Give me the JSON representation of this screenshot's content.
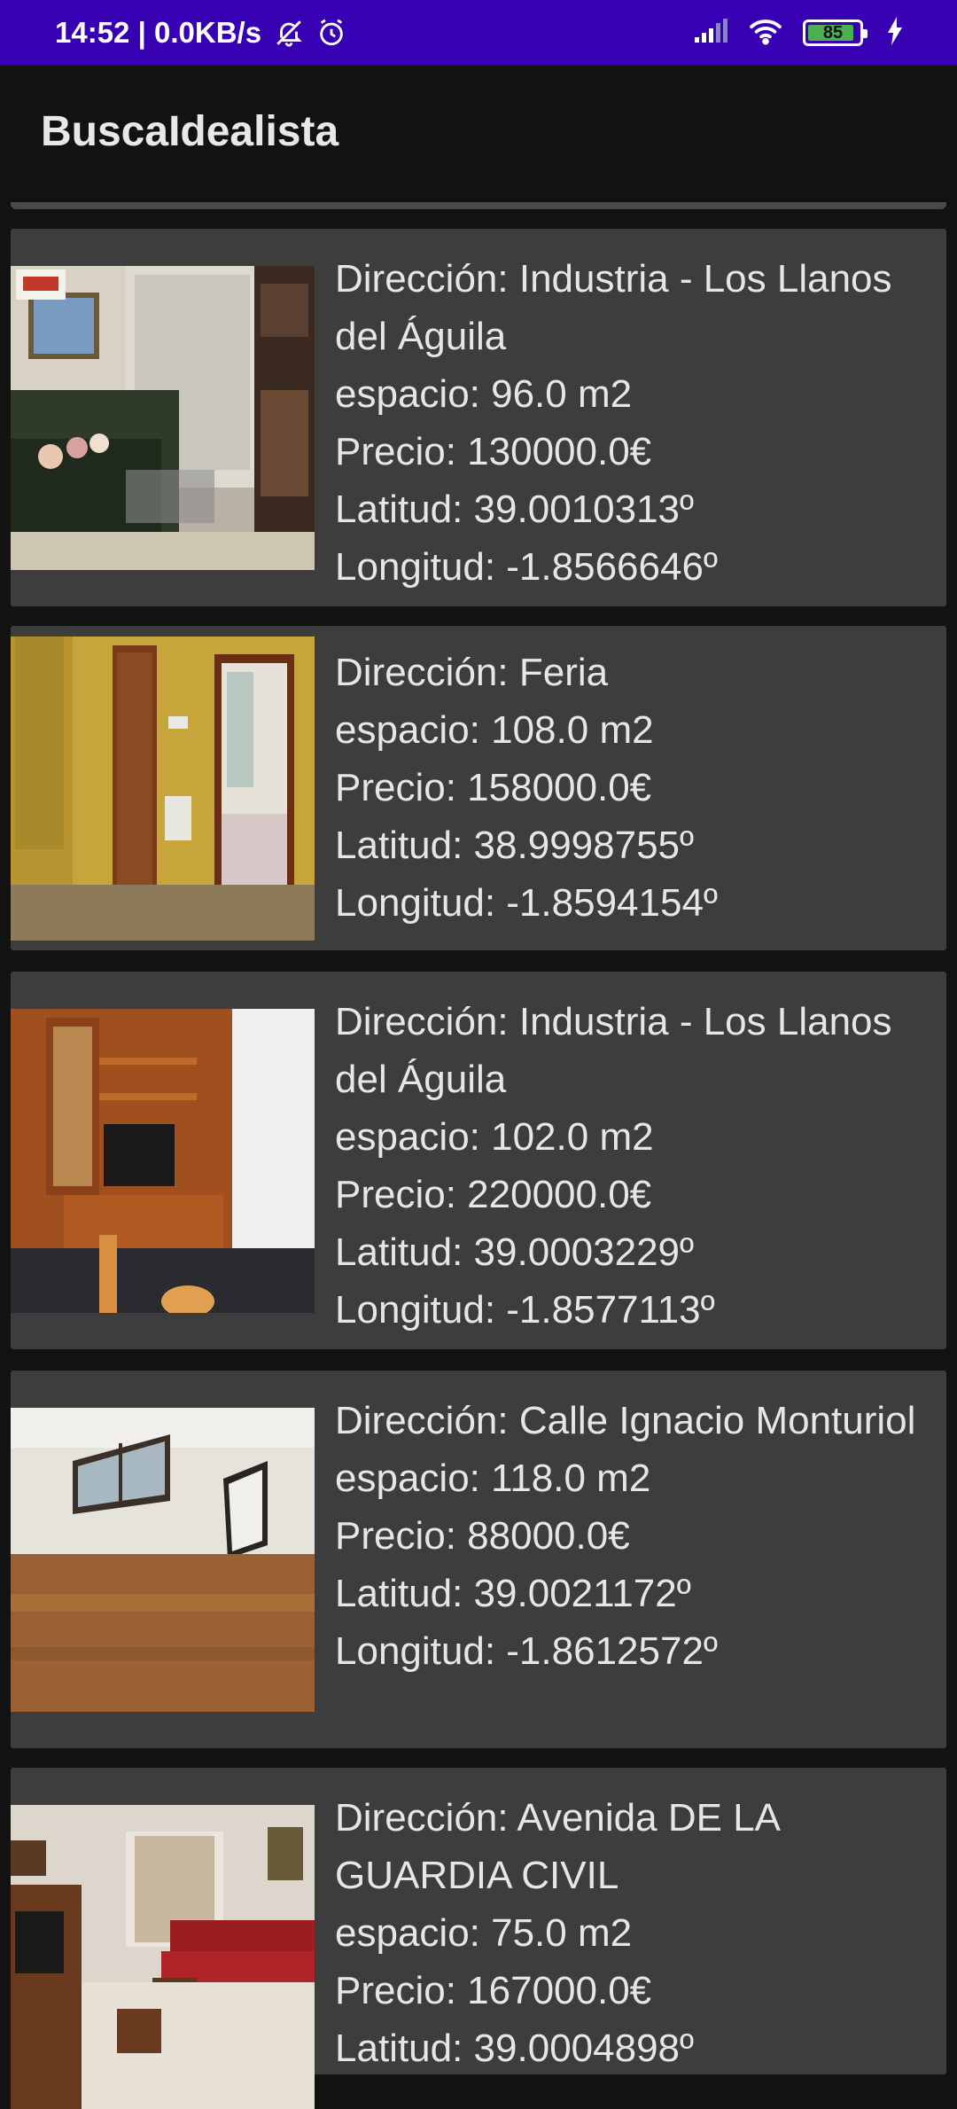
{
  "status_bar": {
    "time": "14:52",
    "network_speed": "0.0KB/s",
    "icons": [
      "mute-icon",
      "alarm-icon",
      "signal-icon",
      "wifi-icon",
      "battery-icon",
      "charging-icon"
    ],
    "battery_level": "85"
  },
  "app_bar": {
    "title": "BuscaIdealista"
  },
  "listings": [
    {
      "direccion": "Dirección: Industria - Los Llanos del Águila",
      "espacio": "espacio: 96.0 m2",
      "precio": "Precio: 130000.0€",
      "latitud": "Latitud: 39.0010313º",
      "longitud": "Longitud: -1.8566646º"
    },
    {
      "direccion": "Dirección: Feria",
      "espacio": "espacio: 108.0 m2",
      "precio": "Precio: 158000.0€",
      "latitud": "Latitud: 38.9998755º",
      "longitud": "Longitud: -1.8594154º"
    },
    {
      "direccion": "Dirección: Industria - Los Llanos del Águila",
      "espacio": "espacio: 102.0 m2",
      "precio": "Precio: 220000.0€",
      "latitud": "Latitud: 39.0003229º",
      "longitud": "Longitud: -1.8577113º"
    },
    {
      "direccion": "Dirección: Calle Ignacio Monturiol",
      "espacio": "espacio: 118.0 m2",
      "precio": "Precio: 88000.0€",
      "latitud": "Latitud: 39.0021172º",
      "longitud": "Longitud: -1.8612572º"
    },
    {
      "direccion": "Dirección: Avenida DE LA GUARDIA CIVIL",
      "espacio": "espacio: 75.0 m2",
      "precio": "Precio: 167000.0€",
      "latitud": "Latitud: 39.0004898º",
      "longitud": ""
    }
  ],
  "colors": {
    "status_bar": "#3700b3",
    "background": "#121212",
    "card": "#3d3d3d",
    "text": "#e6e6e6"
  }
}
